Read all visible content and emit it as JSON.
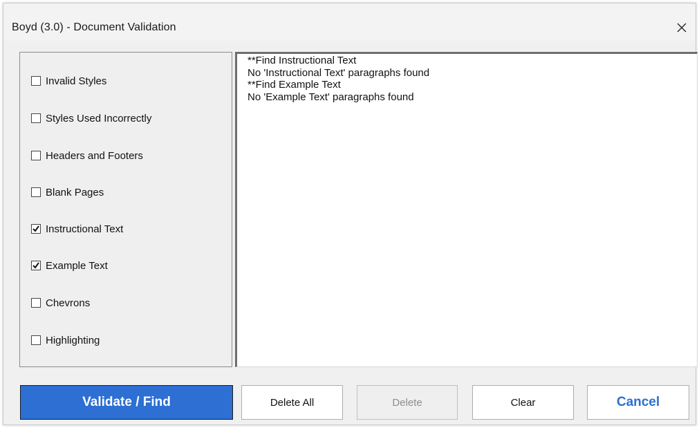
{
  "window": {
    "title": "Boyd (3.0) - Document Validation"
  },
  "checks": [
    {
      "label": "Invalid Styles",
      "checked": false
    },
    {
      "label": "Styles Used Incorrectly",
      "checked": false
    },
    {
      "label": "Headers and Footers",
      "checked": false
    },
    {
      "label": "Blank Pages",
      "checked": false
    },
    {
      "label": "Instructional Text",
      "checked": true
    },
    {
      "label": "Example Text",
      "checked": true
    },
    {
      "label": "Chevrons",
      "checked": false
    },
    {
      "label": "Highlighting",
      "checked": false
    }
  ],
  "results": {
    "lines": [
      "**Find Instructional Text",
      "No 'Instructional Text' paragraphs found",
      "**Find Example Text",
      "No 'Example Text' paragraphs found"
    ]
  },
  "buttons": {
    "validate": "Validate / Find",
    "delete_all": "Delete All",
    "delete": "Delete",
    "clear": "Clear",
    "cancel": "Cancel"
  },
  "colors": {
    "accent": "#2d6fd3",
    "disabled_text": "#8d8d8d"
  }
}
